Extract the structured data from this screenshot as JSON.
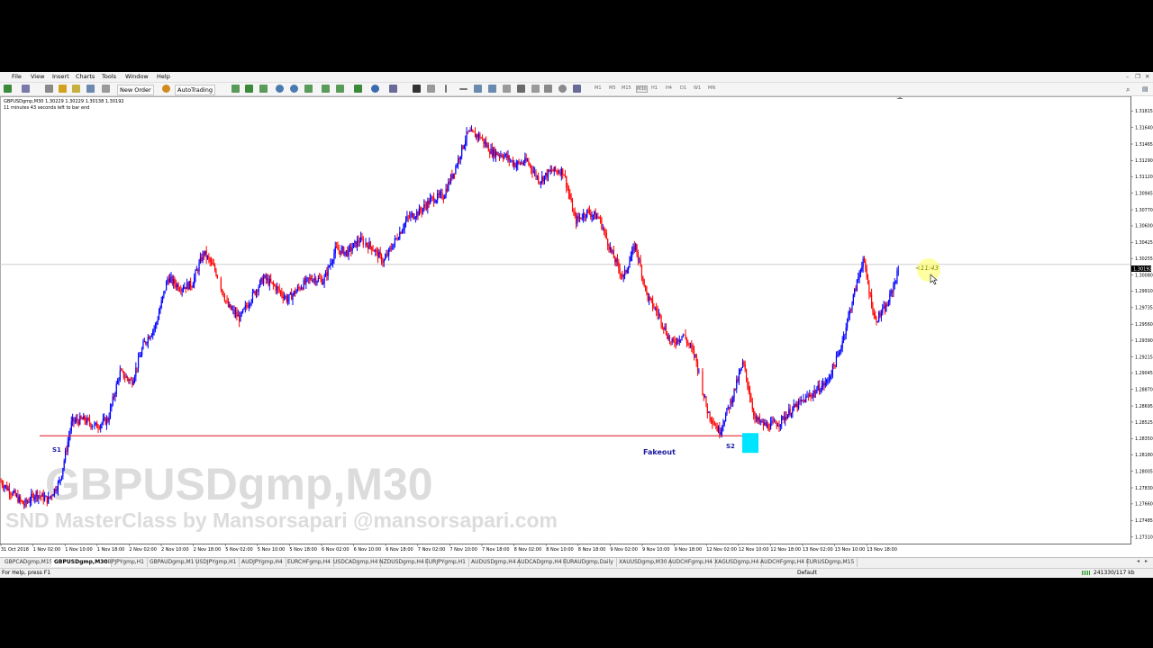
{
  "menu": [
    "File",
    "View",
    "Insert",
    "Charts",
    "Tools",
    "Window",
    "Help"
  ],
  "toolbar": {
    "new_order": "New Order",
    "autotrading": "AutoTrading",
    "timeframes": [
      "M1",
      "M5",
      "M15",
      "M30",
      "H1",
      "H4",
      "D1",
      "W1",
      "MN"
    ]
  },
  "chart": {
    "header_symbol": "GBPUSDgmp,M30  1.30229 1.30229 1.30138 1.30192",
    "header_timer": "11 minutes 43 seconds left to bar end",
    "watermark_title": "GBPUSDgmp,M30",
    "watermark_sub": "SND MasterClass by Mansorsapari @mansorsapari.com",
    "label_s1": "S1",
    "label_s2": "S2",
    "label_fakeout": "Fakeout",
    "countdown": "<11:43",
    "current_price": "1.30192",
    "colors": {
      "bull": "#0000ff",
      "bear": "#ff0000",
      "zone": "#00e5ff",
      "hline": "#e0293a",
      "bid": "#c8c8c8"
    }
  },
  "chart_data": {
    "type": "candlestick",
    "y_ticks": [
      "1.31815",
      "1.31640",
      "1.31465",
      "1.31290",
      "1.31120",
      "1.30945",
      "1.30770",
      "1.30600",
      "1.30425",
      "1.30255",
      "1.30080",
      "1.29910",
      "1.29735",
      "1.29560",
      "1.29390",
      "1.29215",
      "1.29045",
      "1.28870",
      "1.28695",
      "1.28525",
      "1.28350",
      "1.28180",
      "1.28005",
      "1.27830",
      "1.27660",
      "1.27485",
      "1.27310"
    ],
    "ylim": [
      1.2724,
      1.3196
    ],
    "x_ticks": [
      "31 Oct 2018",
      "1 Nov 02:00",
      "1 Nov 10:00",
      "1 Nov 18:00",
      "2 Nov 02:00",
      "2 Nov 10:00",
      "2 Nov 18:00",
      "5 Nov 02:00",
      "5 Nov 10:00",
      "5 Nov 18:00",
      "6 Nov 02:00",
      "6 Nov 10:00",
      "6 Nov 18:00",
      "7 Nov 02:00",
      "7 Nov 10:00",
      "7 Nov 18:00",
      "8 Nov 02:00",
      "8 Nov 10:00",
      "8 Nov 18:00",
      "9 Nov 02:00",
      "9 Nov 10:00",
      "9 Nov 18:00",
      "12 Nov 02:00",
      "12 Nov 10:00",
      "12 Nov 18:00",
      "13 Nov 02:00",
      "13 Nov 10:00",
      "13 Nov 18:00"
    ],
    "support_level": 1.2838,
    "path_prices": [
      [
        0,
        1.279
      ],
      [
        1,
        1.2778
      ],
      [
        2,
        1.2765
      ],
      [
        3,
        1.2777
      ],
      [
        4,
        1.277
      ],
      [
        5,
        1.279
      ],
      [
        6,
        1.2853
      ],
      [
        7,
        1.2855
      ],
      [
        8,
        1.2848
      ],
      [
        9,
        1.2855
      ],
      [
        10,
        1.2905
      ],
      [
        11,
        1.2895
      ],
      [
        12,
        1.2935
      ],
      [
        13,
        1.2955
      ],
      [
        14,
        1.3005
      ],
      [
        15,
        1.2995
      ],
      [
        16,
        1.2998
      ],
      [
        17,
        1.3032
      ],
      [
        18,
        1.3012
      ],
      [
        19,
        1.2975
      ],
      [
        20,
        1.2962
      ],
      [
        21,
        1.2985
      ],
      [
        22,
        1.3005
      ],
      [
        23,
        1.2995
      ],
      [
        24,
        1.2982
      ],
      [
        25,
        1.2995
      ],
      [
        26,
        1.3005
      ],
      [
        27,
        1.3002
      ],
      [
        28,
        1.3035
      ],
      [
        29,
        1.3032
      ],
      [
        30,
        1.3045
      ],
      [
        31,
        1.3038
      ],
      [
        32,
        1.3022
      ],
      [
        33,
        1.3045
      ],
      [
        34,
        1.3068
      ],
      [
        35,
        1.3075
      ],
      [
        36,
        1.3088
      ],
      [
        37,
        1.3092
      ],
      [
        38,
        1.3122
      ],
      [
        39,
        1.3158
      ],
      [
        40,
        1.3155
      ],
      [
        41,
        1.3138
      ],
      [
        42,
        1.3135
      ],
      [
        43,
        1.3125
      ],
      [
        44,
        1.3128
      ],
      [
        45,
        1.3108
      ],
      [
        46,
        1.3118
      ],
      [
        47,
        1.3118
      ],
      [
        48,
        1.3065
      ],
      [
        49,
        1.3075
      ],
      [
        50,
        1.3068
      ],
      [
        51,
        1.3032
      ],
      [
        52,
        1.3005
      ],
      [
        53,
        1.304
      ],
      [
        54,
        1.2985
      ],
      [
        55,
        1.2965
      ],
      [
        56,
        1.2935
      ],
      [
        57,
        1.2945
      ],
      [
        58,
        1.2922
      ],
      [
        59,
        1.2865
      ],
      [
        60,
        1.2842
      ],
      [
        61,
        1.2875
      ],
      [
        62,
        1.2915
      ],
      [
        63,
        1.2855
      ],
      [
        64,
        1.2848
      ],
      [
        65,
        1.2852
      ],
      [
        66,
        1.2865
      ],
      [
        67,
        1.2875
      ],
      [
        68,
        1.2885
      ],
      [
        69,
        1.2895
      ],
      [
        70,
        1.2925
      ],
      [
        71,
        1.2975
      ],
      [
        72,
        1.3025
      ],
      [
        73,
        1.296
      ],
      [
        74,
        1.2975
      ],
      [
        75,
        1.3015
      ]
    ]
  },
  "tabs": [
    "GBPCADgmp,M15",
    "GBPUSDgmp,M30",
    "GBPJPYgmp,H1",
    "GBPAUDgmp,M1",
    "USDJPYgmp,H1",
    "AUDJPYgmp,H4",
    "EURCHFgmp,H4",
    "USDCADgmp,H4",
    "NZDUSDgmp,H4",
    "EURJPYgmp,H1",
    "AUDUSDgmp,H4",
    "AUDCADgmp,H4",
    "EURAUDgmp,Daily",
    "XAUUSDgmp,M30",
    "AUDCHFgmp,H4",
    "XAGUSDgmp,H4",
    "AUDCHFgmp,H4",
    "EURUSDgmp,M15"
  ],
  "active_tab": "GBPUSDgmp,M30",
  "status": {
    "help": "For Help, press F1",
    "profile": "Default",
    "traffic": "241330/117 kb"
  }
}
